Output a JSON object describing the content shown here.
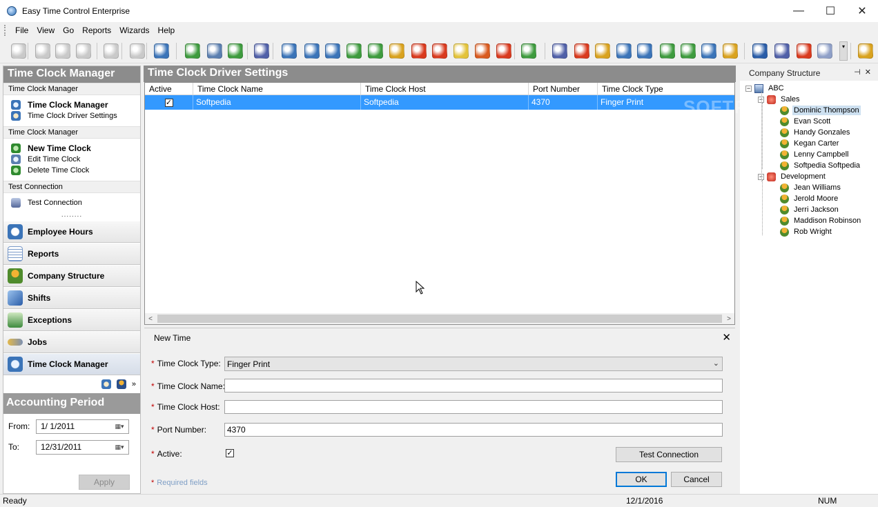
{
  "window": {
    "title": "Easy Time Control Enterprise",
    "minimize": "—",
    "maximize": "☐",
    "close": "✕"
  },
  "menu": [
    "File",
    "View",
    "Go",
    "Reports",
    "Wizards",
    "Help"
  ],
  "left_panel": {
    "header": "Time Clock Manager",
    "groups": [
      {
        "title": "Time Clock Manager",
        "items": [
          {
            "label": "Time Clock Manager",
            "bold": true
          },
          {
            "label": "Time Clock Driver Settings",
            "bold": false
          }
        ]
      },
      {
        "title": "Time Clock Manager",
        "items": [
          {
            "label": "New Time Clock",
            "bold": true
          },
          {
            "label": "Edit Time Clock",
            "bold": false
          },
          {
            "label": "Delete Time Clock",
            "bold": false
          }
        ]
      },
      {
        "title": "Test Connection",
        "items": [
          {
            "label": "Test Connection",
            "bold": false
          }
        ]
      }
    ],
    "splitter": "........",
    "nav_buttons": [
      {
        "label": "Employee Hours",
        "active": false
      },
      {
        "label": "Reports",
        "active": false
      },
      {
        "label": "Company Structure",
        "active": false
      },
      {
        "label": "Shifts",
        "active": false
      },
      {
        "label": "Exceptions",
        "active": false
      },
      {
        "label": "Jobs",
        "active": false
      },
      {
        "label": "Time Clock Manager",
        "active": true
      }
    ],
    "nav_more": "»"
  },
  "accounting": {
    "header": "Accounting Period",
    "from_label": "From:",
    "from_value": "1/  1/2011",
    "to_label": "To:",
    "to_value": "12/31/2011",
    "apply_label": "Apply"
  },
  "center": {
    "header": "Time Clock Driver Settings",
    "columns": [
      "Active",
      "Time Clock Name",
      "Time Clock Host",
      "Port Number",
      "Time Clock Type"
    ],
    "rows": [
      {
        "active": "✓",
        "name": "Softpedia",
        "host": "Softpedia",
        "port": "4370",
        "type": "Finger Print"
      }
    ],
    "watermark": "SOFTPEDIA",
    "scroll_left": "<",
    "scroll_right": ">"
  },
  "form": {
    "title": "New Time",
    "close": "✕",
    "type_label": "Time Clock Type:",
    "type_value": "Finger Print",
    "name_label": "Time Clock Name:",
    "name_value": "",
    "host_label": "Time Clock Host:",
    "host_value": "",
    "port_label": "Port Number:",
    "port_value": "4370",
    "active_label": "Active:",
    "active_check": "✓",
    "required_marker": "*",
    "test_button": "Test Connection",
    "ok_button": "OK",
    "cancel_button": "Cancel",
    "required_note": "Required fields"
  },
  "right_panel": {
    "header": "Company Structure",
    "pin": "📌",
    "close": "✕",
    "root": "ABC",
    "departments": [
      {
        "name": "Sales",
        "employees": [
          "Dominic Thompson",
          "Evan Scott",
          "Handy Gonzales",
          "Kegan Carter",
          "Lenny Campbell",
          "Softpedia Softpedia"
        ]
      },
      {
        "name": "Development",
        "employees": [
          "Jean Williams",
          "Jerold Moore",
          "Jerri Jackson",
          "Maddison Robinson",
          "Rob Wright"
        ]
      }
    ],
    "selected": "Dominic Thompson"
  },
  "status": {
    "left": "Ready",
    "date": "12/1/2016",
    "num": "NUM"
  },
  "colors": {
    "header_gray": "#8c8c8c",
    "selection_blue": "#3399ff",
    "required_red": "#c00000"
  }
}
